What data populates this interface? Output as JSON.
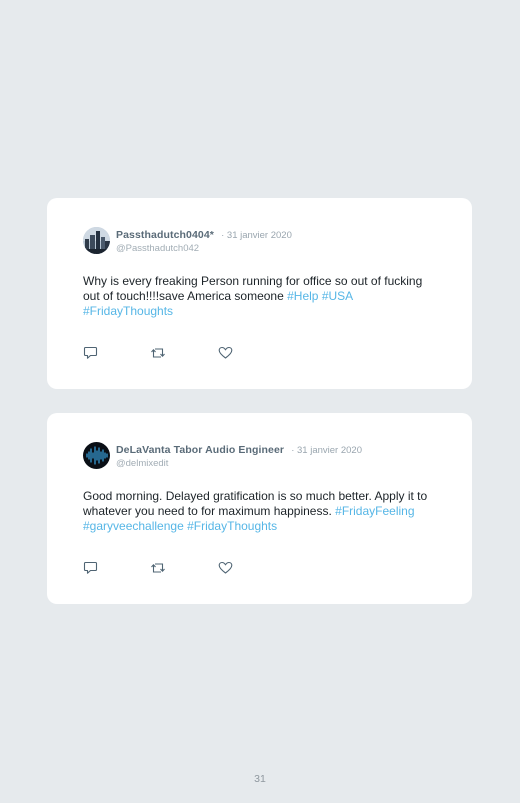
{
  "tweets": [
    {
      "name": "Passthadutch0404*",
      "date": "31 janvier 2020",
      "handle": "@Passthadutch042",
      "text": "Why is every freaking Person running for office so out of fucking out of touch!!!!save America someone",
      "tags": [
        "#Help",
        "#USA",
        "#FridayThoughts"
      ],
      "avatar_icon": "city-skyline-avatar"
    },
    {
      "name": "DeLaVanta Tabor Audio Engineer",
      "date": "31 janvier 2020",
      "handle": "@delmixedit",
      "text": "Good morning. Delayed gratification is so much better. Apply it to whatever you need to for maximum happiness.",
      "tags": [
        "#FridayFeeling",
        "#garyveechallenge",
        "#FridayThoughts"
      ],
      "avatar_icon": "audio-waveform-avatar"
    }
  ],
  "icons": {
    "reply": "reply-icon",
    "retweet": "retweet-icon",
    "like": "heart-icon"
  },
  "colors": {
    "page_background": "#e6eaed",
    "card_background": "#ffffff",
    "hashtag": "#56b6e6",
    "name": "#5a6b78",
    "meta": "#9aa6af"
  },
  "page_number": "31"
}
